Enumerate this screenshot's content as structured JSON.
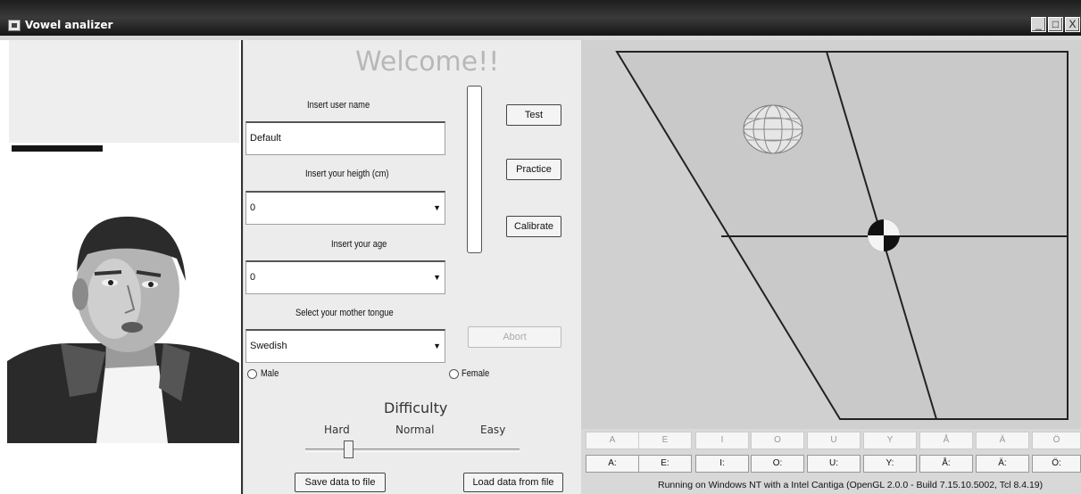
{
  "window": {
    "title": "Vowel analizer",
    "min": "_",
    "max": "□",
    "close": "X"
  },
  "form": {
    "welcome": "Welcome!!",
    "user_label": "Insert user name",
    "user_value": "Default",
    "height_label": "Insert your heigth (cm)",
    "height_value": "0",
    "age_label": "Insert your age",
    "age_value": "0",
    "tongue_label": "Select your mother tongue",
    "tongue_value": "Swedish",
    "male": "Male",
    "female": "Female"
  },
  "buttons": {
    "test": "Test",
    "practice": "Practice",
    "calibrate": "Calibrate",
    "abort": "Abort",
    "save": "Save data to file",
    "load": "Load data from file"
  },
  "difficulty": {
    "title": "Difficulty",
    "hard": "Hard",
    "normal": "Normal",
    "easy": "Easy",
    "level_fraction": 0.2
  },
  "vowels_short": [
    "A",
    "E",
    "I",
    "O",
    "U",
    "Y",
    "Å",
    "Ä",
    "Ö"
  ],
  "vowels_long": [
    "A:",
    "E:",
    "I:",
    "O:",
    "U:",
    "Y:",
    "Å:",
    "Ä:",
    "Ö:"
  ],
  "status": "Running on Windows NT with a Intel Cantiga (OpenGL 2.0.0 - Build 7.15.10.5002, Tcl 8.4.19)"
}
